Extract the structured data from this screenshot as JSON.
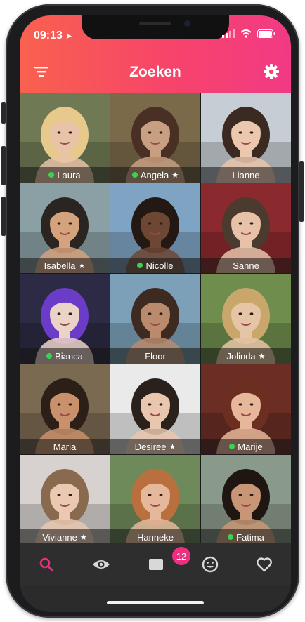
{
  "status_bar": {
    "time": "09:13"
  },
  "header": {
    "title": "Zoeken"
  },
  "profiles": [
    {
      "name": "Laura",
      "online": true,
      "starred": false,
      "bg": "#6f7a55",
      "skin": "#e8c3a8",
      "hair": "#e6c98b"
    },
    {
      "name": "Angela",
      "online": true,
      "starred": true,
      "bg": "#7a6a4a",
      "skin": "#c89f80",
      "hair": "#4a2f25"
    },
    {
      "name": "Lianne",
      "online": false,
      "starred": false,
      "bg": "#c7cdd4",
      "skin": "#eac7ad",
      "hair": "#3b2a22"
    },
    {
      "name": "Isabella",
      "online": false,
      "starred": true,
      "bg": "#8aa0a5",
      "skin": "#d5a27e",
      "hair": "#2b2522"
    },
    {
      "name": "Nicolle",
      "online": true,
      "starred": false,
      "bg": "#7fa3c3",
      "skin": "#6d4634",
      "hair": "#241814"
    },
    {
      "name": "Sanne",
      "online": false,
      "starred": false,
      "bg": "#8b2a2e",
      "skin": "#e7c2a8",
      "hair": "#4b3a2e"
    },
    {
      "name": "Bianca",
      "online": true,
      "starred": false,
      "bg": "#2c2a44",
      "skin": "#ecd3c8",
      "hair": "#6a3cc8"
    },
    {
      "name": "Floor",
      "online": false,
      "starred": false,
      "bg": "#7ba0b8",
      "skin": "#b98b6c",
      "hair": "#3d2a20"
    },
    {
      "name": "Jolinda",
      "online": false,
      "starred": true,
      "bg": "#6f8d4d",
      "skin": "#e6c4a6",
      "hair": "#c9a66a"
    },
    {
      "name": "Maria",
      "online": false,
      "starred": false,
      "bg": "#7a6a52",
      "skin": "#c8916b",
      "hair": "#2c1f18"
    },
    {
      "name": "Desiree",
      "online": false,
      "starred": true,
      "bg": "#eaeaea",
      "skin": "#e9c6ae",
      "hair": "#2a211d"
    },
    {
      "name": "Marije",
      "online": true,
      "starred": false,
      "bg": "#6a2e24",
      "skin": "#e6b79a",
      "hair": "#6b2e20"
    },
    {
      "name": "Vivianne",
      "online": false,
      "starred": true,
      "bg": "#d7d2cf",
      "skin": "#eac8b2",
      "hair": "#8a6a4e"
    },
    {
      "name": "Hanneke",
      "online": false,
      "starred": false,
      "bg": "#6f8a5a",
      "skin": "#e5b89c",
      "hair": "#b9703e"
    },
    {
      "name": "Fatima",
      "online": true,
      "starred": false,
      "bg": "#8a9a8a",
      "skin": "#c89676",
      "hair": "#1f1612"
    }
  ],
  "tabbar": {
    "items": [
      "search-icon",
      "eye-icon",
      "message-icon",
      "smiley-icon",
      "heart-icon"
    ],
    "active": "search-icon",
    "messages_badge": "12"
  },
  "colors": {
    "accent": "#ec2f7f",
    "online": "#3ad24f",
    "header_gradient_start": "#f9614e",
    "header_gradient_end": "#f23a85"
  }
}
